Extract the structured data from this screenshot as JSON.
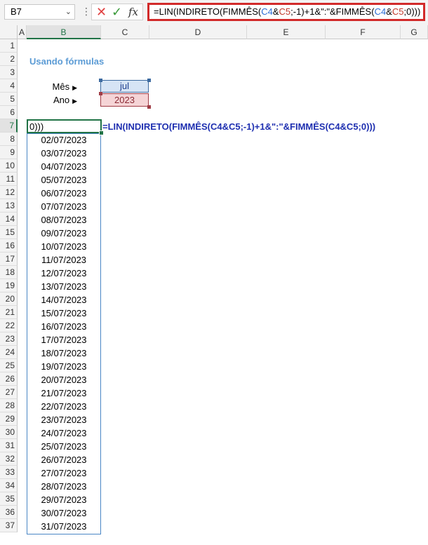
{
  "formula_bar": {
    "name_box": "B7",
    "formula_parts": [
      "=LIN(INDIRETO(FIMMÊS(",
      "C4",
      "&",
      "C5",
      ";-1)+1&\":\"&FIMMÊS(",
      "C4",
      "&",
      "C5",
      ";0)))"
    ]
  },
  "columns": [
    "A",
    "B",
    "C",
    "D",
    "E",
    "F",
    "G"
  ],
  "rows": [
    "1",
    "2",
    "3",
    "4",
    "5",
    "6",
    "7",
    "8",
    "9",
    "10",
    "11",
    "12",
    "13",
    "14",
    "15",
    "16",
    "17",
    "18",
    "19",
    "20",
    "21",
    "22",
    "23",
    "24",
    "25",
    "26",
    "27",
    "28",
    "29",
    "30",
    "31",
    "32",
    "33",
    "34",
    "35",
    "36",
    "37"
  ],
  "sheet": {
    "title": "Usando fórmulas",
    "month_label": "Mês",
    "year_label": "Ano",
    "month_value": "jul",
    "year_value": "2023",
    "active_cell_text": "0)))",
    "formula_text": "=LIN(INDIRETO(FIMMÊS(C4&C5;-1)+1&\":\"&FIMMÊS(C4&C5;0)))",
    "dates": [
      "02/07/2023",
      "03/07/2023",
      "04/07/2023",
      "05/07/2023",
      "06/07/2023",
      "07/07/2023",
      "08/07/2023",
      "09/07/2023",
      "10/07/2023",
      "11/07/2023",
      "12/07/2023",
      "13/07/2023",
      "14/07/2023",
      "15/07/2023",
      "16/07/2023",
      "17/07/2023",
      "18/07/2023",
      "19/07/2023",
      "20/07/2023",
      "21/07/2023",
      "22/07/2023",
      "23/07/2023",
      "24/07/2023",
      "25/07/2023",
      "26/07/2023",
      "27/07/2023",
      "28/07/2023",
      "29/07/2023",
      "30/07/2023",
      "31/07/2023"
    ]
  },
  "colors": {
    "accent_green": "#217346",
    "title_blue": "#5b9bd5",
    "formula_border": "#d22a2a"
  }
}
